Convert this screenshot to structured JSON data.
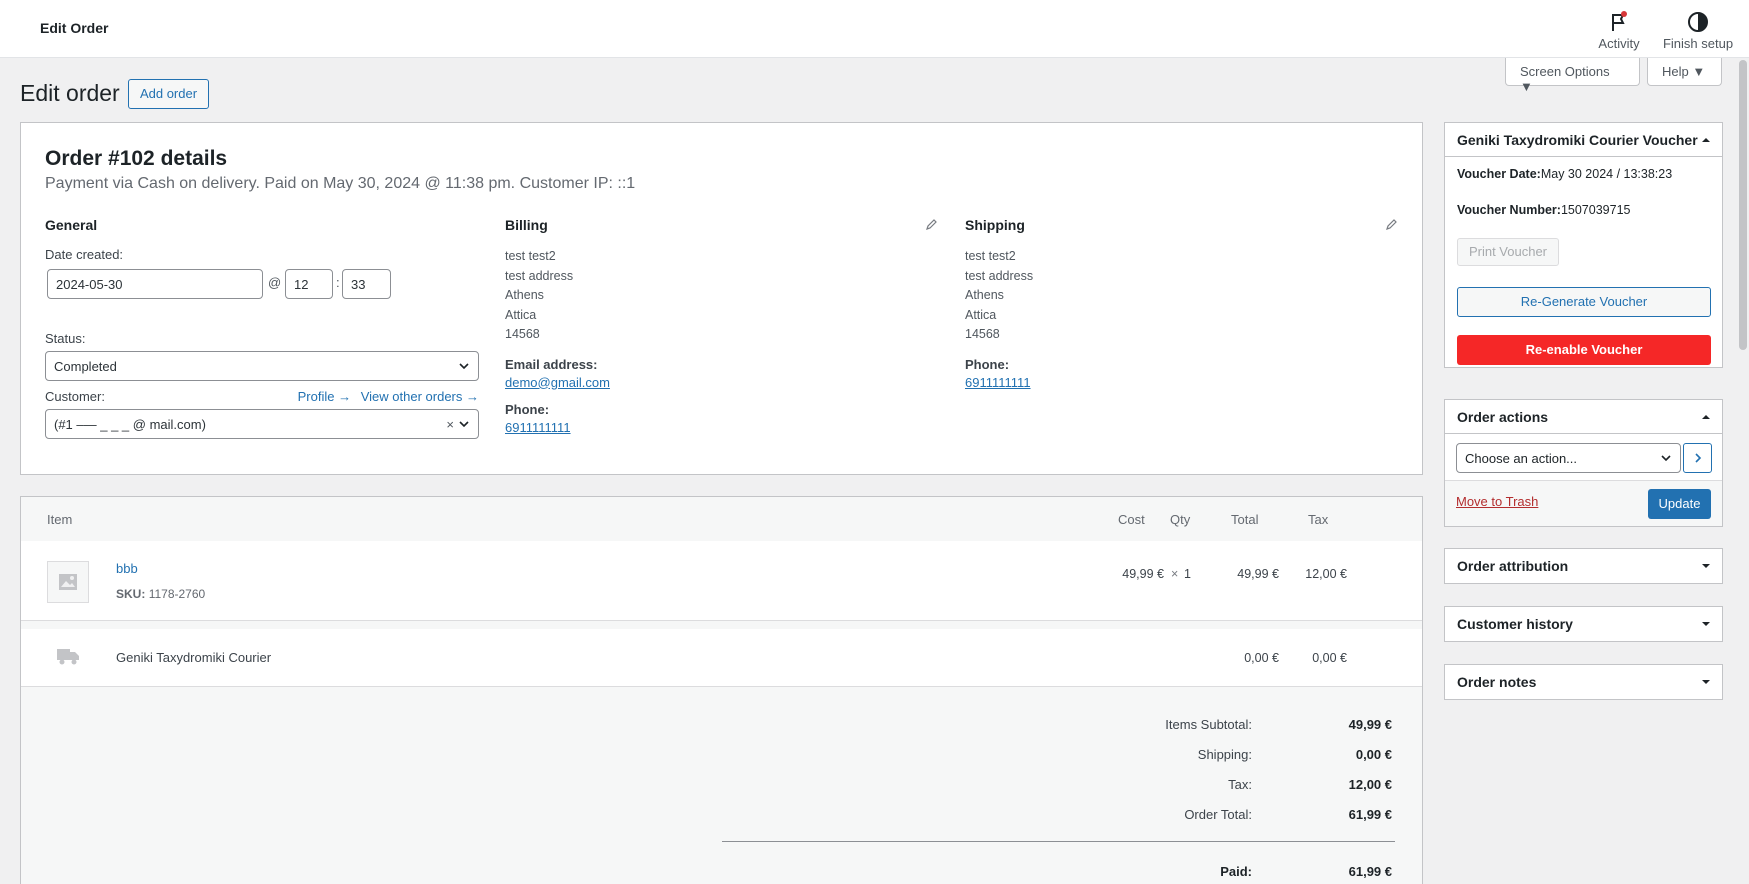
{
  "topbar": {
    "title": "Edit Order",
    "activity_label": "Activity",
    "finish_setup_label": "Finish setup"
  },
  "screen_options": {
    "screen_label": "Screen Options ▼",
    "help_label": "Help ▼"
  },
  "page": {
    "title": "Edit order",
    "add_order_label": "Add order"
  },
  "order": {
    "heading": "Order #102 details",
    "subheading": "Payment via Cash on delivery. Paid on May 30, 2024 @ 11:38 pm. Customer IP: ::1",
    "general": {
      "title": "General",
      "date_label": "Date created:",
      "date_value": "2024-05-30",
      "at": "@",
      "hour": "12",
      "colon": ":",
      "minute": "33",
      "status_label": "Status:",
      "status_value": "Completed",
      "customer_label": "Customer:",
      "profile_link": "Profile →",
      "other_orders_link": "View other orders →",
      "customer_value": "(#1 –—  _ _  _ @ mail.com)",
      "clear_symbol": "×"
    },
    "billing": {
      "title": "Billing",
      "lines": [
        "test test2",
        "test address",
        "Athens",
        "Attica",
        "14568"
      ],
      "email_label": "Email address:",
      "email": "demo@gmail.com",
      "phone_label": "Phone:",
      "phone": "6911111111"
    },
    "shipping": {
      "title": "Shipping",
      "lines": [
        "test test2",
        "test address",
        "Athens",
        "Attica",
        "14568"
      ],
      "phone_label": "Phone:",
      "phone": "6911111111"
    }
  },
  "items": {
    "headers": {
      "item": "Item",
      "cost": "Cost",
      "qty": "Qty",
      "total": "Total",
      "tax": "Tax"
    },
    "product": {
      "name": "bbb",
      "sku_label": "SKU:",
      "sku": "1178-2760",
      "cost": "49,99 €",
      "qty_sym": "×",
      "qty": "1",
      "total": "49,99 €",
      "tax": "12,00 €"
    },
    "shipping_line": {
      "name": "Geniki Taxydromiki Courier",
      "total": "0,00 €",
      "tax": "0,00 €"
    },
    "totals": {
      "subtotal_label": "Items Subtotal:",
      "subtotal": "49,99 €",
      "shipping_label": "Shipping:",
      "shipping": "0,00 €",
      "tax_label": "Tax:",
      "tax": "12,00 €",
      "order_total_label": "Order Total:",
      "order_total": "61,99 €",
      "paid_label": "Paid:",
      "paid": "61,99 €"
    }
  },
  "sidebar": {
    "voucher": {
      "title": "Geniki Taxydromiki Courier Voucher",
      "date_label": "Voucher Date:",
      "date_value": "May 30 2024 / 13:38:23",
      "number_label": "Voucher Number:",
      "number_value": "1507039715",
      "print_label": "Print Voucher",
      "regen_label": "Re-Generate Voucher",
      "reenable_label": "Re-enable Voucher"
    },
    "actions": {
      "title": "Order actions",
      "select_value": "Choose an action...",
      "trash_label": "Move to Trash",
      "update_label": "Update"
    },
    "attribution_title": "Order attribution",
    "history_title": "Customer history",
    "notes_title": "Order notes"
  },
  "colors": {
    "accent": "#2271b1",
    "danger": "#f52727",
    "trash": "#b32d2e"
  }
}
